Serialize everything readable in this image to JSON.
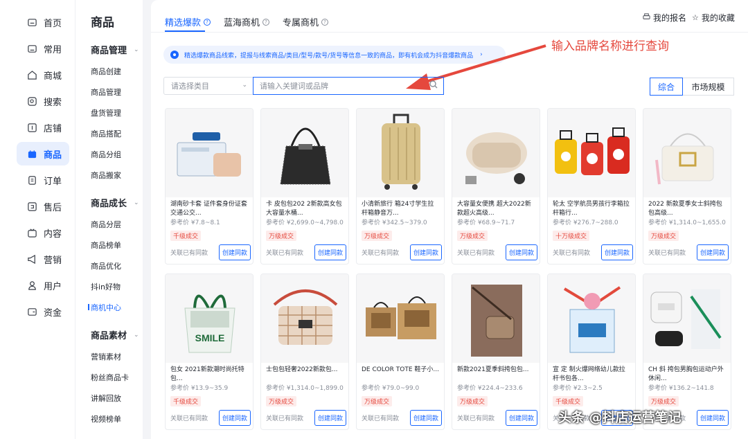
{
  "rail": [
    {
      "label": "首页",
      "icon": "home-icon"
    },
    {
      "label": "常用",
      "icon": "folder-icon"
    },
    {
      "label": "商城",
      "icon": "store-icon"
    },
    {
      "label": "搜索",
      "icon": "search-icon"
    },
    {
      "label": "店铺",
      "icon": "shop-icon"
    },
    {
      "label": "商品",
      "icon": "bag-icon"
    },
    {
      "label": "订单",
      "icon": "order-icon"
    },
    {
      "label": "售后",
      "icon": "aftersale-icon"
    },
    {
      "label": "内容",
      "icon": "content-icon"
    },
    {
      "label": "营销",
      "icon": "megaphone-icon"
    },
    {
      "label": "用户",
      "icon": "user-icon"
    },
    {
      "label": "资金",
      "icon": "wallet-icon"
    }
  ],
  "menu": {
    "title": "商品",
    "groups": [
      {
        "label": "商品管理",
        "items": [
          "商品创建",
          "商品管理",
          "盘货管理",
          "商品搭配",
          "商品分组",
          "商品搬家"
        ]
      },
      {
        "label": "商品成长",
        "items": [
          "商品分层",
          "商品榜单",
          "商品优化",
          "抖in好物",
          "商机中心"
        ]
      },
      {
        "label": "商品素材",
        "items": [
          "营销素材",
          "粉丝商品卡",
          "讲解回放",
          "视频榜单"
        ]
      }
    ]
  },
  "tabs": [
    "精选爆款",
    "蓝海商机",
    "专属商机"
  ],
  "top_links": {
    "signup": "我的报名",
    "favorites": "我的收藏"
  },
  "notice": "精选爆款商品线索，提报与线索商品/类目/型号/款号/货号等信息一致的商品，即有机会成为抖音爆款商品",
  "annotation": "输入品牌名称进行查询",
  "filters": {
    "category_placeholder": "请选择类目",
    "search_placeholder": "请输入关键词或品牌"
  },
  "sort": [
    "综合",
    "市场规模"
  ],
  "cards": [
    {
      "title": "湖南砂卡套 证件套身份证套交通公交...",
      "price": "参考价 ¥7.8~8.1",
      "tag": "千级成交",
      "img": "cardholder"
    },
    {
      "title": "卡 皮包包202 2新款高女包大容量水桶...",
      "price": "参考价 ¥2,699.0~4,798.0",
      "tag": "万级成交",
      "img": "bucketbag"
    },
    {
      "title": "小清新旅行 箱24寸学生拉杆箱静音万...",
      "price": "参考价 ¥342.5~379.0",
      "tag": "万级成交",
      "img": "suitcase"
    },
    {
      "title": "大容量女便携 超大2022新款超火高级...",
      "price": "参考价 ¥68.9~71.7",
      "tag": "万级成交",
      "img": "pouch"
    },
    {
      "title": "轮太 空学航员男孩行李箱拉杆箱行...",
      "price": "参考价 ¥276.7~288.0",
      "tag": "十万级成交",
      "img": "kidscase"
    },
    {
      "title": "2022 新款夏季女士斜挎包包高级...",
      "price": "参考价 ¥1,314.0~1,655.0",
      "tag": "万级成交",
      "img": "whitebag"
    },
    {
      "title": "包女 2021新款潮时尚托特包...",
      "price": "参考价 ¥13.9~35.9",
      "tag": "千级成交",
      "img": "tote"
    },
    {
      "title": "士包包轻奢2022新款包...",
      "price": "参考价 ¥1,314.0~1,899.0",
      "tag": "万级成交",
      "img": "printbag"
    },
    {
      "title": "DE COLOR TOTE 鞋子小...",
      "price": "参考价 ¥79.0~99.0",
      "tag": "万级成交",
      "img": "kraftbag"
    },
    {
      "title": "新款2021夏季斜挎包包...",
      "price": "参考价 ¥224.4~233.6",
      "tag": "万级成交",
      "img": "crossbody"
    },
    {
      "title": "宣 定 制火爆网络幼儿款拉杆书包各...",
      "price": "参考价 ¥2.3~2.5",
      "tag": "千级成交",
      "img": "gift"
    },
    {
      "title": "CH 斜 挎包男胸包运动户外休闲...",
      "price": "参考价 ¥136.2~141.8",
      "tag": "万级成交",
      "img": "waistbag"
    }
  ],
  "card_common": {
    "similar": "关联已有同款",
    "create": "创建同款"
  },
  "watermark": "头条 @抖店运营笔记",
  "colors": {
    "accent": "#1966ff",
    "annotation": "#e5483d"
  }
}
